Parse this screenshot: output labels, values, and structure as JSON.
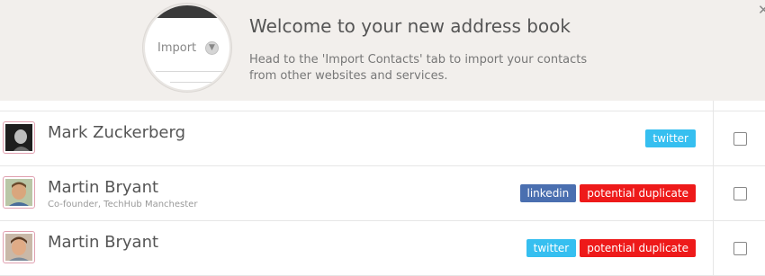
{
  "banner": {
    "title": "Welcome to your new address book",
    "text": "Head to the 'Import Contacts' tab to import your contacts from other websites and services.",
    "illustration_label": "Import",
    "close_icon": "close-icon"
  },
  "colors": {
    "twitter": "#36bff0",
    "linkedin": "#4a6fb0",
    "potential_duplicate": "#ee1a1a"
  },
  "contacts": [
    {
      "name": "Mark Zuckerberg",
      "subtitle": "",
      "tags": [
        "twitter"
      ]
    },
    {
      "name": "Martin Bryant",
      "subtitle": "Co-founder, TechHub Manchester",
      "tags": [
        "linkedin",
        "potential duplicate"
      ]
    },
    {
      "name": "Martin Bryant",
      "subtitle": "",
      "tags": [
        "twitter",
        "potential duplicate"
      ]
    }
  ]
}
